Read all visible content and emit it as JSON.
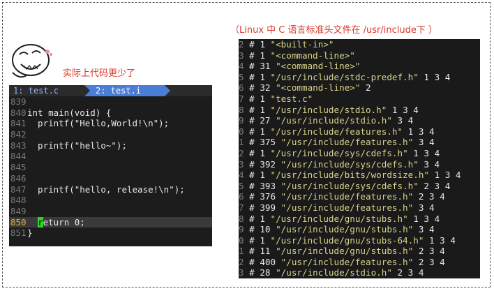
{
  "caption_text": "实际上代码更少了",
  "right_title": "（Linux 中 C 语言标准头文件在 /usr/include下 ）",
  "editor": {
    "tabs": [
      "1: test.c",
      "2: test.i"
    ],
    "lines": [
      {
        "num": "839",
        "text": ""
      },
      {
        "num": "840",
        "text": "int main(void) {"
      },
      {
        "num": "841",
        "text": "  printf(\"Hello,World!\\n\");"
      },
      {
        "num": "842",
        "text": ""
      },
      {
        "num": "843",
        "text": "  printf(\"hello~\");"
      },
      {
        "num": "844",
        "text": ""
      },
      {
        "num": "845",
        "text": ""
      },
      {
        "num": "846",
        "text": ""
      },
      {
        "num": "847",
        "text": "  printf(\"hello, release!\\n\");"
      },
      {
        "num": "848",
        "text": ""
      },
      {
        "num": "849",
        "text": ""
      },
      {
        "num": "850",
        "text": "  return 0;"
      },
      {
        "num": "851",
        "text": "}"
      }
    ]
  },
  "terminal": {
    "lines": [
      {
        "n": "2",
        "rest": " # 1 \"<built-in>\""
      },
      {
        "n": "3",
        "rest": " # 1 \"<command-line>\""
      },
      {
        "n": "4",
        "rest": " # 31 \"<command-line>\""
      },
      {
        "n": "5",
        "rest": " # 1 \"/usr/include/stdc-predef.h\" 1 3 4"
      },
      {
        "n": "6",
        "rest": " # 32 \"<command-line>\" 2"
      },
      {
        "n": "7",
        "rest": " # 1 \"test.c\""
      },
      {
        "n": "8",
        "rest": " # 1 \"/usr/include/stdio.h\" 1 3 4"
      },
      {
        "n": "9",
        "rest": " # 27 \"/usr/include/stdio.h\" 3 4"
      },
      {
        "n": "0",
        "rest": " # 1 \"/usr/include/features.h\" 1 3 4"
      },
      {
        "n": "1",
        "rest": " # 375 \"/usr/include/features.h\" 3 4"
      },
      {
        "n": "2",
        "rest": " # 1 \"/usr/include/sys/cdefs.h\" 1 3 4"
      },
      {
        "n": "3",
        "rest": " # 392 \"/usr/include/sys/cdefs.h\" 3 4"
      },
      {
        "n": "4",
        "rest": " # 1 \"/usr/include/bits/wordsize.h\" 1 3 4"
      },
      {
        "n": "5",
        "rest": " # 393 \"/usr/include/sys/cdefs.h\" 2 3 4"
      },
      {
        "n": "6",
        "rest": " # 376 \"/usr/include/features.h\" 2 3 4"
      },
      {
        "n": "7",
        "rest": " # 399 \"/usr/include/features.h\" 3 4"
      },
      {
        "n": "8",
        "rest": " # 1 \"/usr/include/gnu/stubs.h\" 1 3 4"
      },
      {
        "n": "9",
        "rest": " # 10 \"/usr/include/gnu/stubs.h\" 3 4"
      },
      {
        "n": "0",
        "rest": " # 1 \"/usr/include/gnu/stubs-64.h\" 1 3 4"
      },
      {
        "n": "1",
        "rest": " # 11 \"/usr/include/gnu/stubs.h\" 2 3 4"
      },
      {
        "n": "2",
        "rest": " # 400 \"/usr/include/features.h\" 2 3 4"
      },
      {
        "n": "3",
        "rest": " # 28 \"/usr/include/stdio.h\" 2 3 4"
      }
    ]
  }
}
